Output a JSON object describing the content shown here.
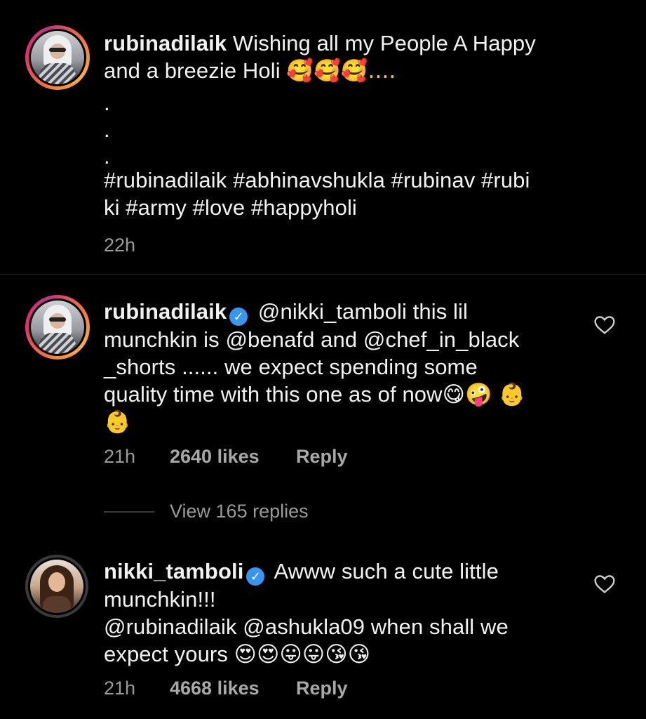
{
  "caption": {
    "username": "rubinadilaik",
    "line1": "Wishing all my People A Happy",
    "line2_text": "and  a breezie Holi",
    "line2_emoji": "🥰🥰🥰....",
    "dots": [
      ".",
      ".",
      "."
    ],
    "hashtags_line1": "#rubinadilaik #abhinavshukla #rubinav  #rubi",
    "hashtags_line2": "ki #army #love #happyholi",
    "time": "22h"
  },
  "comments": [
    {
      "username": "rubinadilaik",
      "verified": true,
      "lines": [
        "@nikki_tamboli this lil",
        "munchkin is @benafd and @chef_in_black",
        "_shorts ...... we expect spending some",
        "quality time with this one as of now😋🤪 👶",
        "👶"
      ],
      "time": "21h",
      "likes": "2640 likes",
      "reply_label": "Reply",
      "view_replies": "View 165 replies"
    },
    {
      "username": "nikki_tamboli",
      "verified": true,
      "lines": [
        "Awww such a cute little",
        "munchkin!!!",
        "@rubinadilaik @ashukla09 when shall we",
        "expect yours 😍😍😛😛😘😘"
      ],
      "time": "21h",
      "likes": "4668 likes",
      "reply_label": "Reply"
    }
  ],
  "icons": {
    "verified": "verified-badge-icon",
    "like": "heart-outline-icon"
  },
  "colors": {
    "background": "#000000",
    "text": "#f2f2f2",
    "meta": "#9a9a9a",
    "verified": "#3797f0"
  }
}
